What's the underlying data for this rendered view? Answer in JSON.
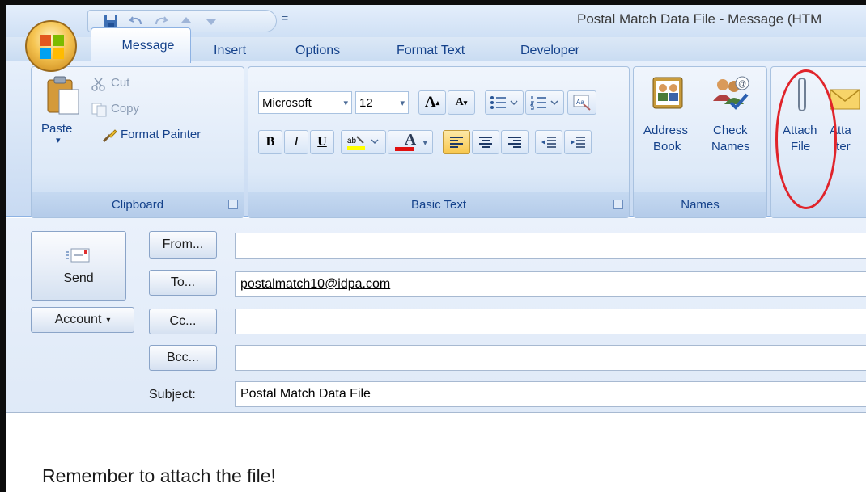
{
  "window": {
    "title": "Postal Match Data File - Message (HTM"
  },
  "quick_access": {
    "items": [
      {
        "name": "save-icon"
      },
      {
        "name": "undo-icon"
      },
      {
        "name": "redo-icon"
      },
      {
        "name": "previous-item-icon"
      },
      {
        "name": "next-item-icon"
      }
    ],
    "customize_symbol": "="
  },
  "tabs": {
    "message": "Message",
    "insert": "Insert",
    "options": "Options",
    "format_text": "Format Text",
    "developer": "Developer"
  },
  "ribbon": {
    "clipboard": {
      "label": "Clipboard",
      "paste": "Paste",
      "cut": "Cut",
      "copy": "Copy",
      "format_painter": "Format Painter"
    },
    "basic_text": {
      "label": "Basic Text",
      "font_name": "Microsoft",
      "font_size": "12",
      "bold": "B",
      "italic": "I",
      "underline": "U",
      "grow_font": "A",
      "shrink_font": "A",
      "font_color": "A"
    },
    "names": {
      "label": "Names",
      "address_book_line1": "Address",
      "address_book_line2": "Book",
      "check_names_line1": "Check",
      "check_names_line2": "Names"
    },
    "include": {
      "attach_file_line1": "Attach",
      "attach_file_line2": "File",
      "attach_item_line1": "Atta",
      "attach_item_line2": "Iter"
    }
  },
  "compose": {
    "send": "Send",
    "account": "Account",
    "from_button": "From...",
    "to_button": "To...",
    "cc_button": "Cc...",
    "bcc_button": "Bcc...",
    "subject_label": "Subject:",
    "from_value": "",
    "to_value": "postalmatch10@idpa.com",
    "cc_value": "",
    "bcc_value": "",
    "subject_value": "Postal Match Data File",
    "body_text": "Remember to attach the file!"
  },
  "colors": {
    "accent": "#15428b",
    "ribbon_bg": "#d6e4f6",
    "annotation_circle": "#e0242b"
  }
}
